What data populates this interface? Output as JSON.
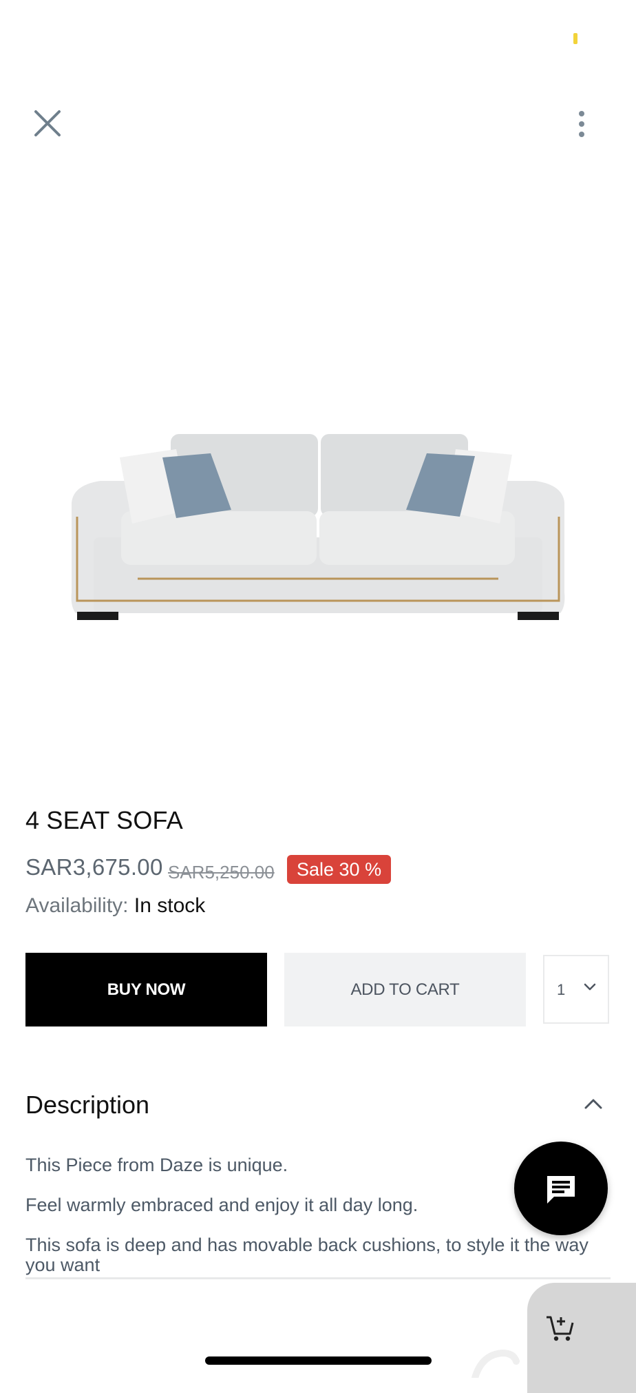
{
  "header": {
    "close_icon": "close-icon",
    "more_icon": "more-vertical-icon"
  },
  "product": {
    "title": "4 SEAT SOFA",
    "price": "SAR3,675.00",
    "compare_price": "SAR5,250.00",
    "sale_badge": "Sale 30 %",
    "availability_label": "Availability:",
    "availability_value": "In stock",
    "image_alt": "4 seat sofa"
  },
  "actions": {
    "buy_now_label": "BUY NOW",
    "add_to_cart_label": "ADD TO CART",
    "quantity_value": "1"
  },
  "description": {
    "heading": "Description",
    "lines": [
      "This Piece from Daze is unique.",
      "Feel warmly embraced and enjoy it all day long.",
      "This sofa is deep and has movable back cushions, to style it the way you want"
    ]
  },
  "colors": {
    "sale": "#d9433a",
    "primary_button": "#000000",
    "secondary_button": "#f1f2f3"
  },
  "icons": {
    "chat": "chat-icon",
    "cart": "cart-add-icon",
    "chevron_down": "chevron-down-icon",
    "chevron_up": "chevron-up-icon"
  }
}
